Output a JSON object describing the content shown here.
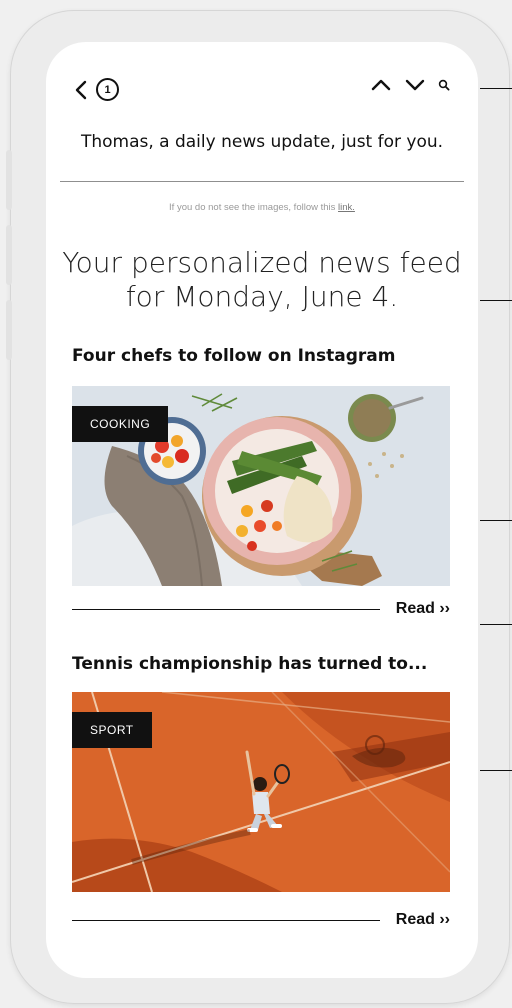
{
  "header": {
    "back_icon": "chevron-left-icon",
    "notification_count": "1",
    "prev_icon": "chevron-up-icon",
    "next_icon": "chevron-down-icon",
    "search_icon": "search-icon"
  },
  "greeting": "Thomas, a daily news update, just for you.",
  "images_notice": {
    "text": "If you do not see the images, follow this ",
    "link_text": "link."
  },
  "feed": {
    "title_line1": "Your personalized news feed",
    "title_line2": "for Monday, June 4."
  },
  "articles": [
    {
      "title": "Four chefs to follow on Instagram",
      "tag": "COOKING",
      "read_label": "Read ››"
    },
    {
      "title": "Tennis championship has turned to...",
      "tag": "SPORT",
      "read_label": "Read ››"
    }
  ],
  "colors": {
    "ink": "#111111",
    "clay": "#d9652a",
    "tabletop": "#dde4ea",
    "screen": "#ffffff"
  }
}
